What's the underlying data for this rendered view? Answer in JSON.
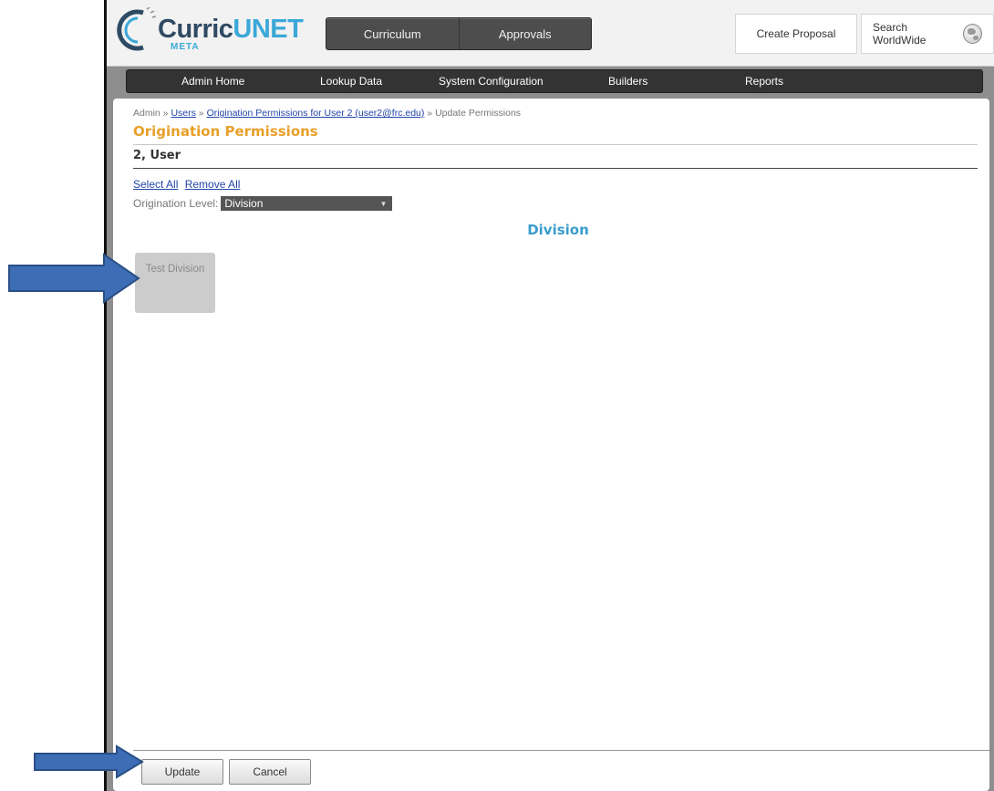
{
  "header": {
    "logo": {
      "brand_prefix": "Curric",
      "brand_suffix": "UNET",
      "sub": "META"
    },
    "top_tabs": [
      {
        "label": "Curriculum"
      },
      {
        "label": "Approvals"
      }
    ],
    "create_proposal_label": "Create Proposal",
    "search_label": "Search WorldWide"
  },
  "admin_nav": {
    "items": [
      {
        "label": "Admin Home"
      },
      {
        "label": "Lookup Data"
      },
      {
        "label": "System Configuration"
      },
      {
        "label": "Builders"
      },
      {
        "label": "Reports"
      }
    ]
  },
  "breadcrumb": {
    "root": "Admin",
    "sep": " » ",
    "users": "Users",
    "origination": "Origination Permissions for User 2 (user2@frc.edu)",
    "current": "Update Permissions"
  },
  "page": {
    "title": "Origination Permissions",
    "user_name": "2, User",
    "select_all": "Select All",
    "remove_all": "Remove All",
    "level_label": "Origination Level:",
    "level_value": "Division",
    "section_title": "Division",
    "tiles": [
      {
        "label": "Test Division"
      }
    ]
  },
  "footer": {
    "update_label": "Update",
    "cancel_label": "Cancel"
  },
  "colors": {
    "title_orange": "#e8a02a",
    "section_blue": "#3a9dcc",
    "link_blue": "#2245a8",
    "arrow_blue": "#3c6db5"
  }
}
